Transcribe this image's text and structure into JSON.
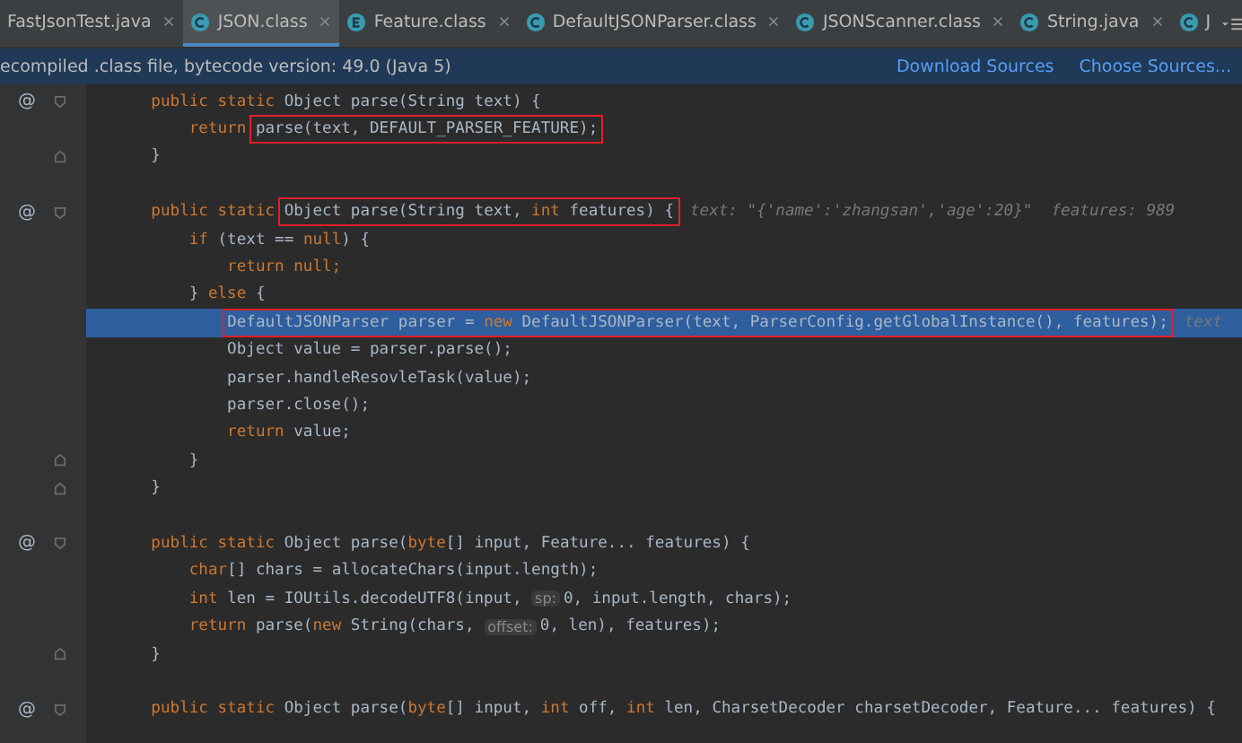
{
  "tabs": [
    {
      "label": "FastJsonTest.java",
      "kind": "plain",
      "selected": false
    },
    {
      "label": "JSON.class",
      "kind": "class",
      "selected": true
    },
    {
      "label": "Feature.class",
      "kind": "enum",
      "selected": false
    },
    {
      "label": "DefaultJSONParser.class",
      "kind": "class",
      "selected": false
    },
    {
      "label": "JSONScanner.class",
      "kind": "class",
      "selected": false
    },
    {
      "label": "String.java",
      "kind": "class",
      "selected": false
    },
    {
      "label": "J",
      "kind": "class",
      "selected": false
    }
  ],
  "banner": {
    "message": "ecompiled .class file, bytecode version: 49.0 (Java 5)",
    "links": [
      "Download Sources",
      "Choose Sources..."
    ]
  },
  "lines": [
    {
      "marker": "@",
      "kind": "opener",
      "highlighted": false,
      "segments": [
        {
          "kind": "kw",
          "text": "    public static "
        },
        {
          "kind": "plain",
          "text": "Object parse(String text) {"
        }
      ]
    },
    {
      "kind": "plain",
      "highlighted": false,
      "segments": [
        {
          "kind": "kw",
          "text": "        return "
        },
        {
          "kind": "box",
          "segments": [
            {
              "kind": "plain",
              "text": "parse(text, DEFAULT_PARSER_FEATURE);"
            }
          ]
        }
      ]
    },
    {
      "kind": "closer",
      "highlighted": false,
      "segments": [
        {
          "kind": "plain",
          "text": "    }"
        }
      ]
    },
    {
      "kind": "blank",
      "highlighted": false
    },
    {
      "marker": "@",
      "kind": "opener",
      "highlighted": false,
      "segments": [
        {
          "kind": "kw",
          "text": "    public static "
        },
        {
          "kind": "box",
          "segments": [
            {
              "kind": "plain",
              "text": "Object parse(String text, "
            },
            {
              "kind": "kw",
              "text": "int "
            },
            {
              "kind": "plain",
              "text": "features) {"
            }
          ]
        },
        {
          "kind": "hint",
          "text": "text: \"{'name':'zhangsan','age':20}\"  features: 989"
        }
      ]
    },
    {
      "kind": "plain",
      "highlighted": false,
      "segments": [
        {
          "kind": "kw",
          "text": "        if "
        },
        {
          "kind": "plain",
          "text": "(text == "
        },
        {
          "kind": "kw",
          "text": "null"
        },
        {
          "kind": "plain",
          "text": ") {"
        }
      ]
    },
    {
      "kind": "plain",
      "highlighted": false,
      "segments": [
        {
          "kind": "kw",
          "text": "            return null;"
        }
      ]
    },
    {
      "kind": "plain",
      "highlighted": false,
      "segments": [
        {
          "kind": "plain",
          "text": "        } "
        },
        {
          "kind": "kw",
          "text": "else "
        },
        {
          "kind": "plain",
          "text": "{"
        }
      ]
    },
    {
      "kind": "plain",
      "highlighted": true,
      "segments": [
        {
          "kind": "box",
          "segments": [
            {
              "kind": "plain",
              "text": "            DefaultJSONParser parser = "
            },
            {
              "kind": "kw",
              "text": "new "
            },
            {
              "kind": "plain",
              "text": "DefaultJSONParser(text, ParserConfig.getGlobalInstance(), features);"
            }
          ]
        },
        {
          "kind": "hint",
          "text": "text"
        }
      ]
    },
    {
      "kind": "plain",
      "highlighted": false,
      "segments": [
        {
          "kind": "plain",
          "text": "            Object value = parser.parse();"
        }
      ]
    },
    {
      "kind": "plain",
      "highlighted": false,
      "segments": [
        {
          "kind": "plain",
          "text": "            parser.handleResovleTask(value);"
        }
      ]
    },
    {
      "kind": "plain",
      "highlighted": false,
      "segments": [
        {
          "kind": "plain",
          "text": "            parser.close();"
        }
      ]
    },
    {
      "kind": "plain",
      "highlighted": false,
      "segments": [
        {
          "kind": "kw",
          "text": "            return "
        },
        {
          "kind": "plain",
          "text": "value;"
        }
      ]
    },
    {
      "kind": "closer",
      "highlighted": false,
      "segments": [
        {
          "kind": "plain",
          "text": "        }"
        }
      ]
    },
    {
      "kind": "closer",
      "highlighted": false,
      "segments": [
        {
          "kind": "plain",
          "text": "    }"
        }
      ]
    },
    {
      "kind": "blank",
      "highlighted": false
    },
    {
      "marker": "@",
      "kind": "opener",
      "highlighted": false,
      "segments": [
        {
          "kind": "kw",
          "text": "    public static "
        },
        {
          "kind": "plain",
          "text": "Object parse("
        },
        {
          "kind": "kw",
          "text": "byte"
        },
        {
          "kind": "plain",
          "text": "[] input, Feature... features) {"
        }
      ]
    },
    {
      "kind": "plain",
      "highlighted": false,
      "segments": [
        {
          "kind": "kw",
          "text": "        char"
        },
        {
          "kind": "plain",
          "text": "[] chars = allocateChars(input.length);"
        }
      ]
    },
    {
      "kind": "plain",
      "highlighted": false,
      "segments": [
        {
          "kind": "kw",
          "text": "        int "
        },
        {
          "kind": "plain",
          "text": "len = IOUtils.decodeUTF8(input, "
        },
        {
          "kind": "inlay",
          "text": "sp:"
        },
        {
          "kind": "plain",
          "text": "0, input.length, chars);"
        }
      ]
    },
    {
      "kind": "plain",
      "highlighted": false,
      "segments": [
        {
          "kind": "kw",
          "text": "        return "
        },
        {
          "kind": "plain",
          "text": "parse("
        },
        {
          "kind": "kw",
          "text": "new "
        },
        {
          "kind": "plain",
          "text": "String(chars, "
        },
        {
          "kind": "inlay",
          "text": "offset:"
        },
        {
          "kind": "plain",
          "text": "0, len), features);"
        }
      ]
    },
    {
      "kind": "closer",
      "highlighted": false,
      "segments": [
        {
          "kind": "plain",
          "text": "    }"
        }
      ]
    },
    {
      "kind": "blank",
      "highlighted": false
    },
    {
      "marker": "@",
      "kind": "opener",
      "highlighted": false,
      "segments": [
        {
          "kind": "kw",
          "text": "    public static "
        },
        {
          "kind": "plain",
          "text": "Object parse("
        },
        {
          "kind": "kw",
          "text": "byte"
        },
        {
          "kind": "plain",
          "text": "[] input, "
        },
        {
          "kind": "kw",
          "text": "int "
        },
        {
          "kind": "plain",
          "text": "off, "
        },
        {
          "kind": "kw",
          "text": "int "
        },
        {
          "kind": "plain",
          "text": "len, CharsetDecoder charsetDecoder, Feature... features) {"
        }
      ]
    }
  ]
}
